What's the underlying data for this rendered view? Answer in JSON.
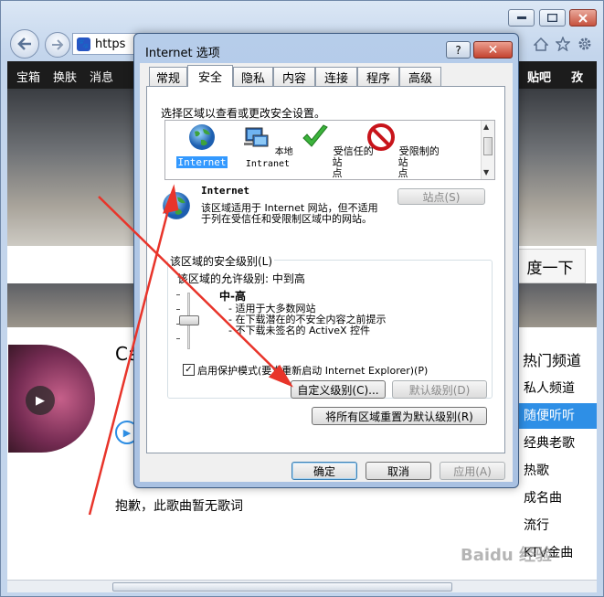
{
  "browser": {
    "address_prefix": "https",
    "paw_glyph": "🐾",
    "site_nav": [
      "宝箱",
      "换肤",
      "消息"
    ],
    "site_nav_right": [
      "贴吧",
      "孜"
    ],
    "search_button": "度一下",
    "song_title_partial": "Ca",
    "no_lyrics": "抱歉，此歌曲暂无歌词",
    "right_panel_title": "热门频道",
    "right_panel_items": [
      "私人频道",
      "随便听听",
      "经典老歌",
      "热歌",
      "成名曲",
      "流行",
      "KTV金曲"
    ],
    "right_panel_active": 1,
    "watermark": "Baidu 经验"
  },
  "dialog": {
    "title": "Internet 选项",
    "help": "?",
    "close": "✕",
    "tabs": [
      "常规",
      "安全",
      "隐私",
      "内容",
      "连接",
      "程序",
      "高级"
    ],
    "active_tab": 1,
    "select_zone_label": "选择区域以查看或更改安全设置。",
    "zones": [
      {
        "label": "Internet",
        "icon": "globe-icon",
        "selected": true
      },
      {
        "label": "本地\nIntranet",
        "icon": "network-icon",
        "selected": false
      },
      {
        "label": "受信任的站\n点",
        "icon": "checkmark-icon",
        "selected": false
      },
      {
        "label": "受限制的站\n点",
        "icon": "no-entry-icon",
        "selected": false
      }
    ],
    "zone_name": "Internet",
    "zone_desc": "该区域适用于 Internet 网站，但不适用于列在受信任和受限制区域中的网站。",
    "sites_button": "站点(S)",
    "security_level_label": "该区域的安全级别(L)",
    "allowed_level": "该区域的允许级别: 中到高",
    "level_name": "中-高",
    "level_bullets": [
      "- 适用于大多数网站",
      "- 在下载潜在的不安全内容之前提示",
      "- 不下载未签名的 ActiveX 控件"
    ],
    "protected_mode_checked": true,
    "protected_mode_label": "启用保护模式(要求重新启动 Internet Explorer)(P)",
    "custom_level_button": "自定义级别(C)...",
    "default_level_button": "默认级别(D)",
    "reset_all_button": "将所有区域重置为默认级别(R)",
    "ok_button": "确定",
    "cancel_button": "取消",
    "apply_button": "应用(A)"
  },
  "colors": {
    "annotation": "#e8342a",
    "accent": "#2e8fe6"
  }
}
